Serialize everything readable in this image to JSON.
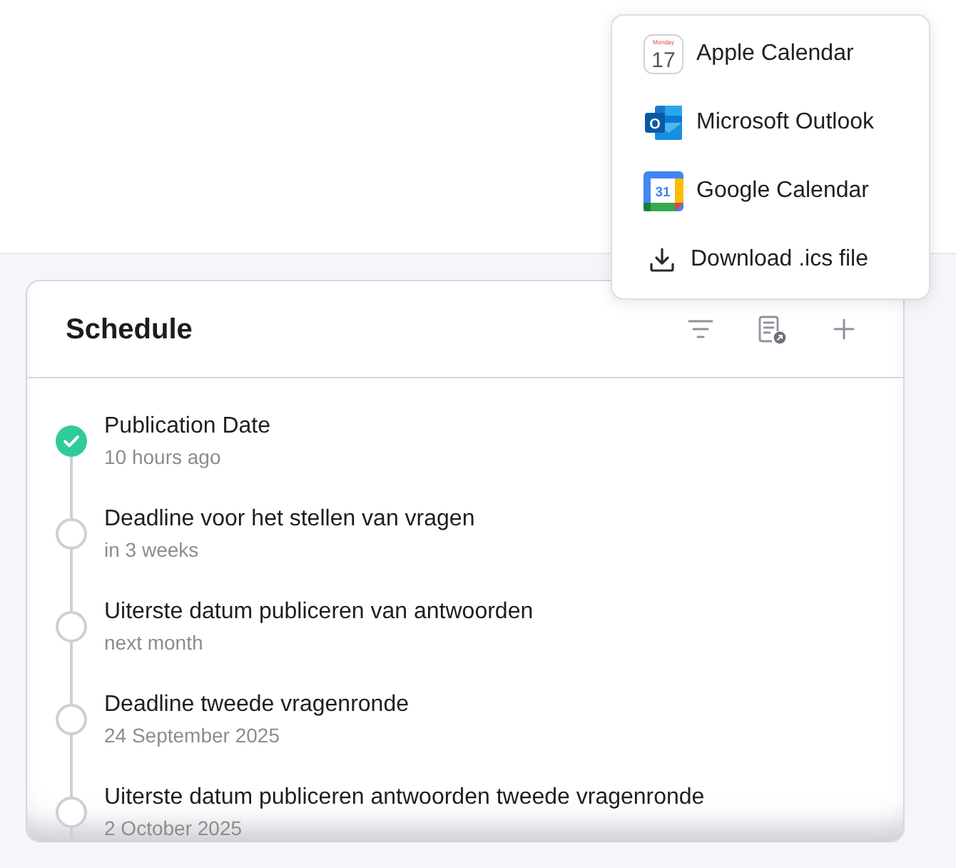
{
  "menu": {
    "items": [
      {
        "kind": "apple",
        "label": "Apple Calendar",
        "icon_day": "Monday",
        "icon_date": "17"
      },
      {
        "kind": "outlook",
        "label": "Microsoft Outlook",
        "icon_letter": "O"
      },
      {
        "kind": "google",
        "label": "Google Calendar",
        "icon_date": "31"
      },
      {
        "kind": "download",
        "label": "Download .ics file"
      }
    ]
  },
  "schedule": {
    "title": "Schedule",
    "events": [
      {
        "title": "Publication Date",
        "when": "10 hours ago",
        "completed": true
      },
      {
        "title": "Deadline voor het stellen van vragen",
        "when": "in 3 weeks",
        "completed": false
      },
      {
        "title": "Uiterste datum publiceren van antwoorden",
        "when": "next month",
        "completed": false
      },
      {
        "title": "Deadline tweede vragenronde",
        "when": "24 September 2025",
        "completed": false
      },
      {
        "title": "Uiterste datum publiceren antwoorden tweede vragenronde",
        "when": "2 October 2025",
        "completed": false
      }
    ]
  }
}
